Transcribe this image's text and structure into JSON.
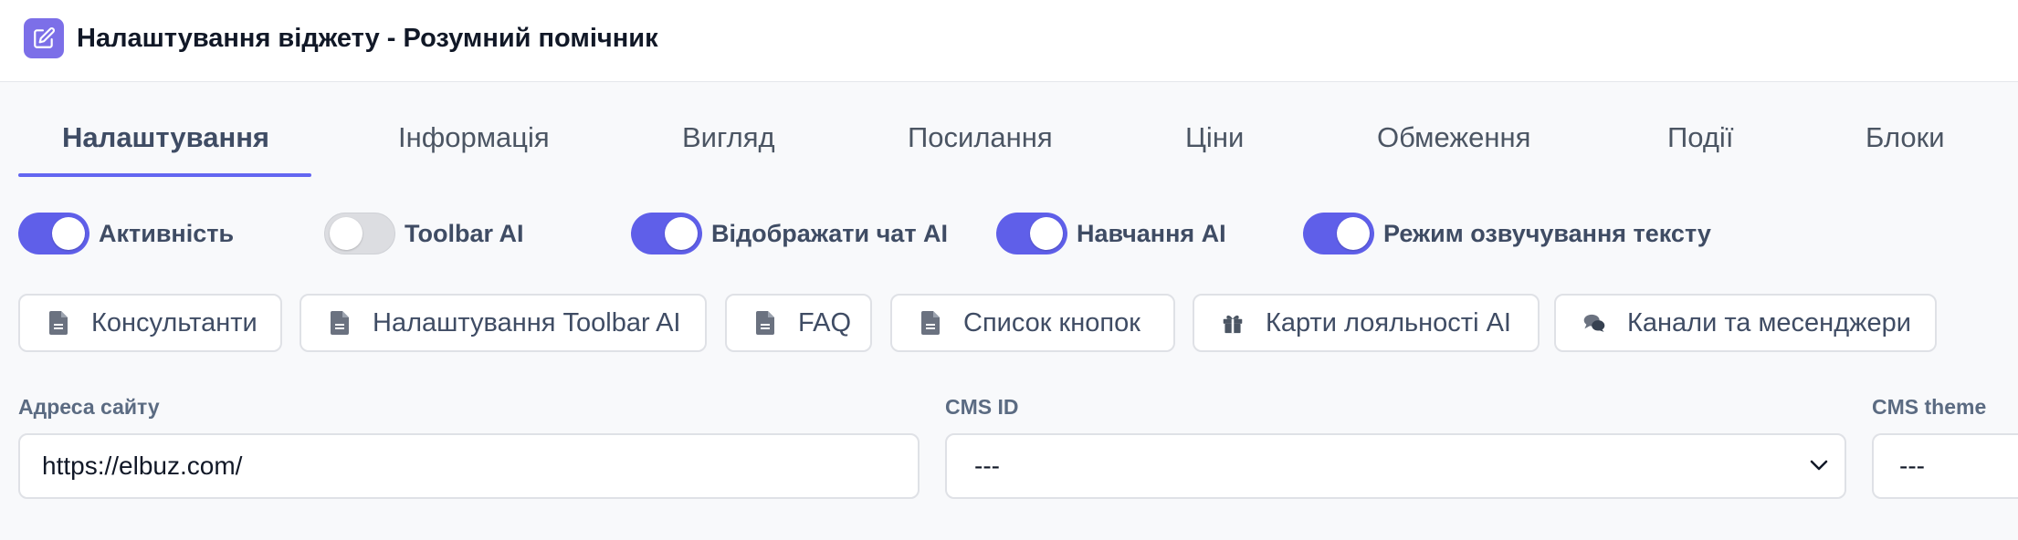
{
  "header": {
    "title": "Налаштування віджету - Розумний помічник",
    "icon": "edit-icon",
    "accent": "#7c6fe8"
  },
  "tabs": [
    {
      "label": "Налаштування",
      "active": true
    },
    {
      "label": "Інформація",
      "active": false
    },
    {
      "label": "Вигляд",
      "active": false
    },
    {
      "label": "Посилання",
      "active": false
    },
    {
      "label": "Ціни",
      "active": false
    },
    {
      "label": "Обмеження",
      "active": false
    },
    {
      "label": "Події",
      "active": false
    },
    {
      "label": "Блоки",
      "active": false
    }
  ],
  "toggles": [
    {
      "label": "Активність",
      "on": true
    },
    {
      "label": "Toolbar AI",
      "on": false
    },
    {
      "label": "Відображати чат AI",
      "on": true
    },
    {
      "label": "Навчання AI",
      "on": true
    },
    {
      "label": "Режим озвучування тексту",
      "on": true
    }
  ],
  "chips": [
    {
      "label": "Консультанти",
      "icon": "document-icon"
    },
    {
      "label": "Налаштування Toolbar AI",
      "icon": "document-icon"
    },
    {
      "label": "FAQ",
      "icon": "document-icon"
    },
    {
      "label": "Список кнопок",
      "icon": "document-icon"
    },
    {
      "label": "Карти лояльності AI",
      "icon": "gift-icon"
    },
    {
      "label": "Канали та месенджери",
      "icon": "chat-bubbles-icon"
    }
  ],
  "fields": {
    "site_address": {
      "label": "Адреса сайту",
      "value": "https://elbuz.com/"
    },
    "cms_id": {
      "label": "CMS ID",
      "value": "---"
    },
    "cms_theme": {
      "label": "CMS theme",
      "value": "---"
    }
  },
  "colors": {
    "toggle_on": "#5f5fe9",
    "tab_underline": "#6366f1"
  }
}
